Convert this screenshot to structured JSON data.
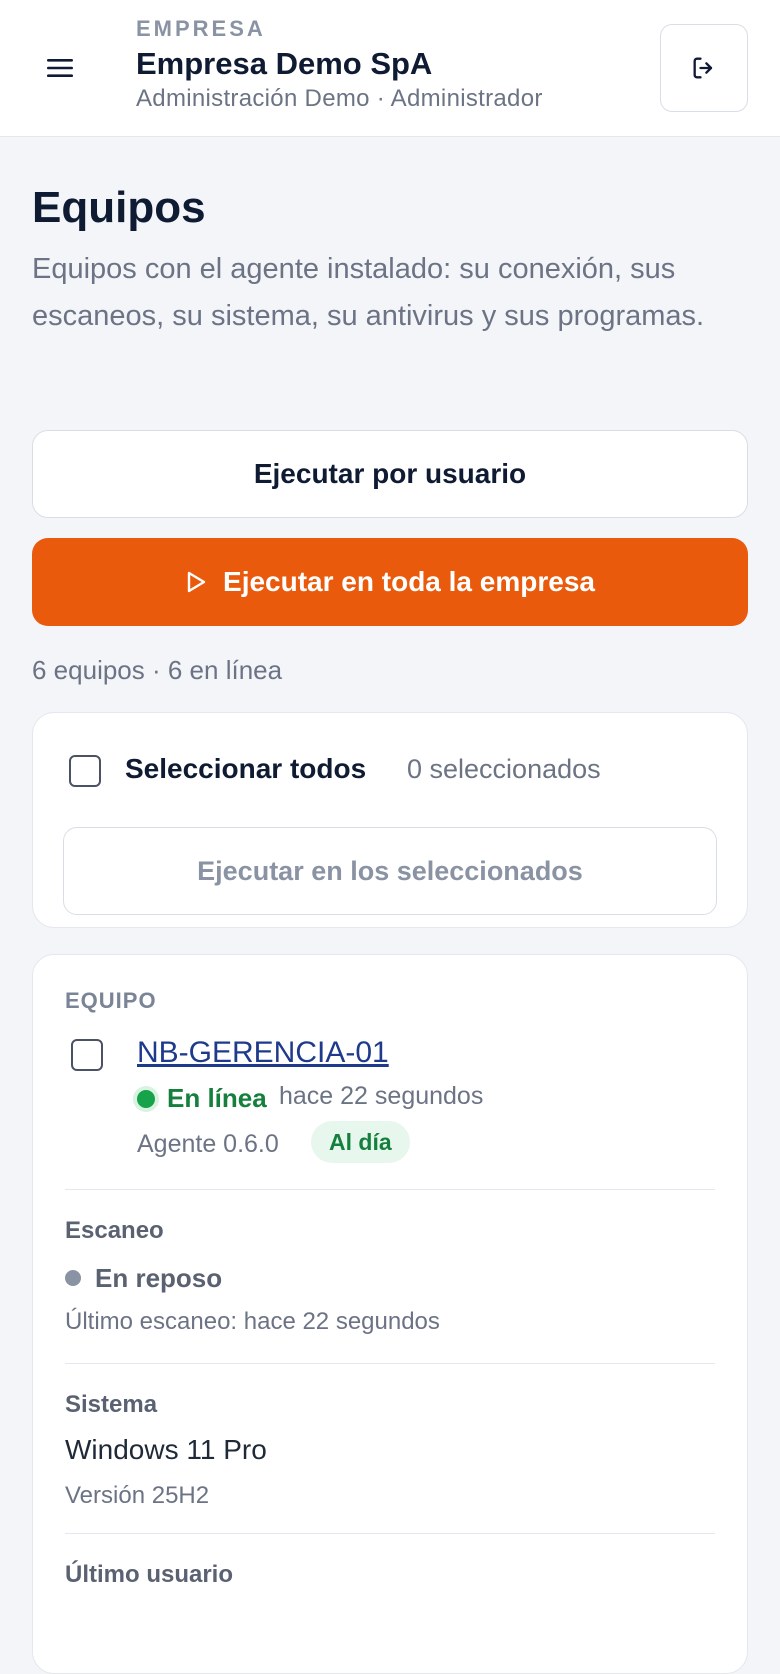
{
  "header": {
    "kicker": "EMPRESA",
    "company": "Empresa Demo SpA",
    "subtitle": "Administración Demo · Administrador"
  },
  "page": {
    "title": "Equipos",
    "description": "Equipos con el agente instalado: su conexión, sus escaneos, su sistema, su antivirus y sus programas."
  },
  "actions": {
    "run_by_user": "Ejecutar por usuario",
    "run_company": "Ejecutar en toda la empresa"
  },
  "summary": "6 equipos · 6 en línea",
  "selection": {
    "select_all": "Seleccionar todos",
    "selected_count": "0 seleccionados",
    "run_selected": "Ejecutar en los seleccionados"
  },
  "device": {
    "section_label": "EQUIPO",
    "name": "NB-GERENCIA-01",
    "status": "En línea",
    "last_seen": "hace 22 segundos",
    "agent": "Agente 0.6.0",
    "agent_badge": "Al día",
    "scan_title": "Escaneo",
    "scan_status": "En reposo",
    "scan_last": "Último escaneo: hace 22 segundos",
    "system_title": "Sistema",
    "system_os": "Windows 11 Pro",
    "system_version": "Versión 25H2",
    "user_title": "Último usuario"
  },
  "colors": {
    "primary": "#ea5a0c",
    "online": "#16a34a",
    "idle": "#8a93a3",
    "link": "#1e3a8a"
  }
}
